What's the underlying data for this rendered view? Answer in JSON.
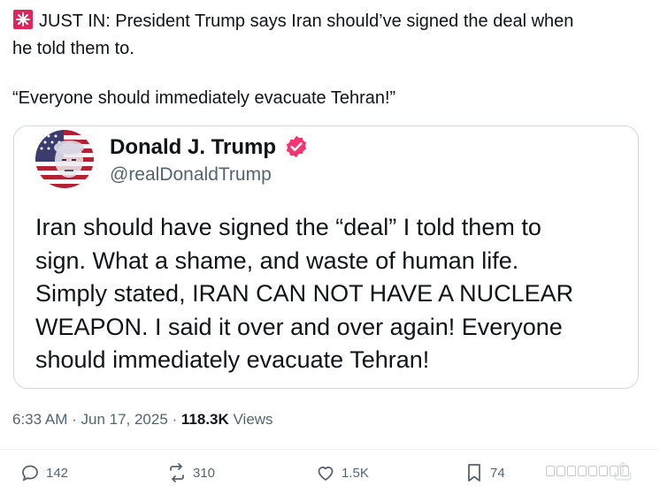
{
  "post": {
    "headline_line1": "JUST IN: President Trump says Iran should’ve signed the deal when",
    "headline_line2": "he told them to.",
    "quote_line": "“Everyone should immediately evacuate Tehran!”"
  },
  "quoted_post": {
    "author_name": "Donald J. Trump",
    "author_handle": "@realDonaldTrump",
    "body_lines": [
      "Iran should have signed the “deal” I told them to",
      "sign. What a shame, and waste of human life.",
      "Simply stated, IRAN CAN NOT HAVE A NUCLEAR",
      "WEAPON. I said it over and over again! Everyone",
      "should immediately evacuate Tehran!"
    ]
  },
  "meta": {
    "time": "6:33 AM",
    "separator": " · ",
    "date": "Jun 17, 2025",
    "views_count": "118.3K",
    "views_label": " Views"
  },
  "actions": {
    "replies": "142",
    "reposts": "310",
    "likes": "1.5K",
    "bookmarks": "74"
  },
  "colors": {
    "text_primary": "#0f1419",
    "text_secondary": "#536471",
    "border": "#cfd9de",
    "verified_badge": "#f4356f",
    "siren": "#e0245e"
  }
}
